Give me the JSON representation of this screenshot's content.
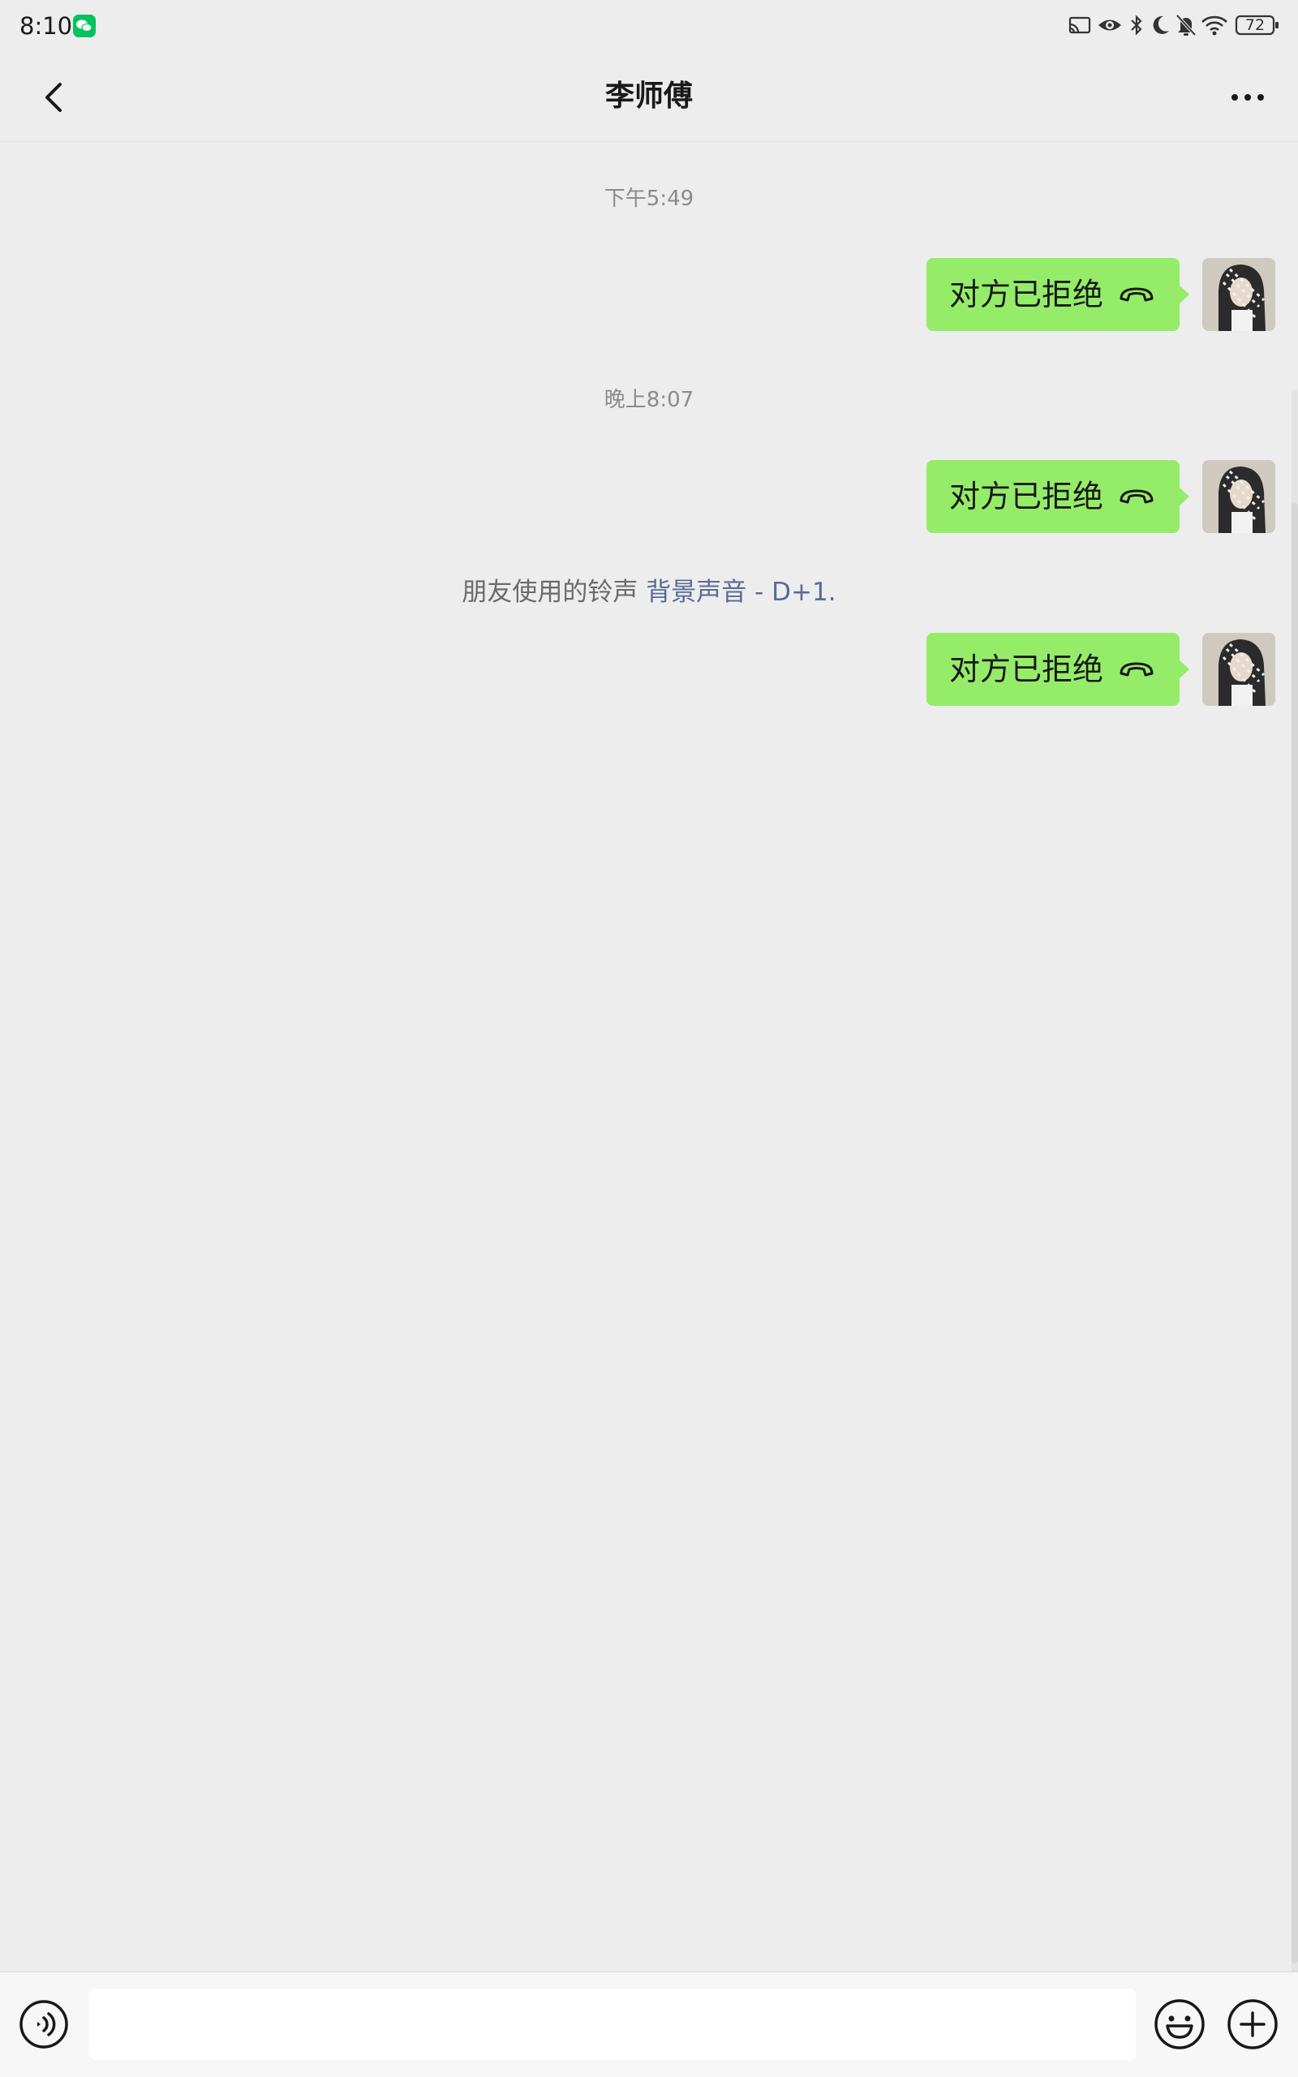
{
  "status_bar": {
    "time": "8:10",
    "battery_level": "72",
    "icons": [
      "wechat-icon",
      "cast-icon",
      "eye-icon",
      "bluetooth-icon",
      "moon-icon",
      "bell-off-icon",
      "wifi-icon",
      "battery-icon"
    ],
    "accent_color": "#07c160"
  },
  "header": {
    "title": "李师傅",
    "back_icon": "chevron-left-icon",
    "more_icon": "more-dots-icon"
  },
  "messages": [
    {
      "type": "timestamp",
      "text": "下午5:49"
    },
    {
      "type": "call",
      "direction": "outgoing",
      "text": "对方已拒绝",
      "icon": "hangup-icon"
    },
    {
      "type": "timestamp",
      "text": "晚上8:07"
    },
    {
      "type": "call",
      "direction": "outgoing",
      "text": "对方已拒绝",
      "icon": "hangup-icon"
    },
    {
      "type": "system",
      "prefix": "朋友使用的铃声",
      "link": "背景声音 - D+1."
    },
    {
      "type": "call",
      "direction": "outgoing",
      "text": "对方已拒绝",
      "icon": "hangup-icon"
    }
  ],
  "input_bar": {
    "value": "",
    "voice_icon": "voice-icon",
    "emoji_icon": "emoji-icon",
    "plus_icon": "plus-circle-icon"
  },
  "colors": {
    "background": "#ededed",
    "bubble": "#95ec69",
    "link": "#576b95",
    "timestamp": "#8b8b8b"
  }
}
